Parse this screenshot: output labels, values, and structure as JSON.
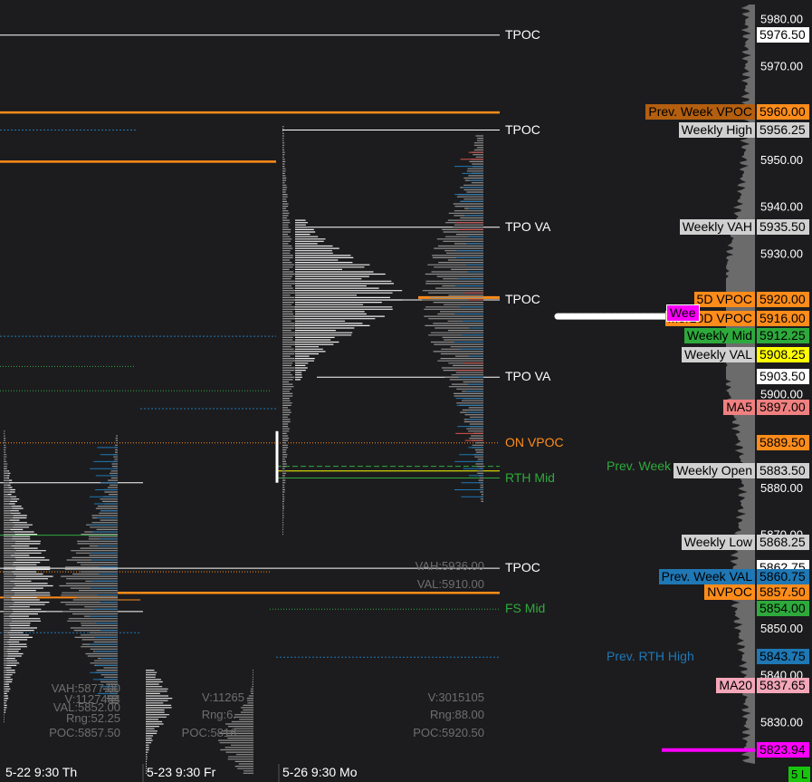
{
  "chart_data": {
    "type": "market-profile",
    "y_axis": {
      "min": 5821,
      "max": 5984,
      "ticks": [
        "5980.00",
        "5970.00",
        "5950.00",
        "5940.00",
        "5930.00",
        "5900.00",
        "5880.00",
        "5870.00",
        "5850.00",
        "5840.00",
        "5830.00"
      ]
    },
    "sessions": [
      {
        "date_label": "5-22  9:30 Th",
        "stats": [
          "VAH:5877.00",
          "V:1127484",
          "VAL:5852.00",
          "Rng:52.25",
          "POC:5857.50"
        ]
      },
      {
        "date_label": "5-23  9:30 Fr",
        "stats": [
          "V:11265",
          "Rng:6.",
          "POC:5816."
        ]
      },
      {
        "date_label": "5-26  9:30 Mo",
        "stats": [
          "VAH:5936.00",
          "VAL:5910.00",
          "V:3015105",
          "Rng:88.00",
          "POC:5920.50"
        ]
      }
    ],
    "chart_lines": [
      {
        "label": "TPOC",
        "price": 5976.5,
        "color": "#ffffff"
      },
      {
        "label": "TPOC",
        "price": 5956.25,
        "color": "#ffffff"
      },
      {
        "label": "TPO VA",
        "price": 5935.5,
        "color": "#ffffff"
      },
      {
        "label": "TPOC",
        "price": 5920.0,
        "color": "#ffffff"
      },
      {
        "label": "TPO VA",
        "price": 5903.5,
        "color": "#ffffff"
      },
      {
        "label": "ON VPOC",
        "price": 5889.5,
        "color": "#ff8c1a"
      },
      {
        "label": "Prev. Week",
        "price": 5884.5,
        "color": "#2eaa3c"
      },
      {
        "label": "RTH Mid",
        "price": 5882.0,
        "color": "#2eaa3c"
      },
      {
        "label": "TPOC",
        "price": 5862.75,
        "color": "#ffffff"
      },
      {
        "label": "FS Mid",
        "price": 5854.0,
        "color": "#2eaa3c"
      },
      {
        "label": "Prev. RTH High",
        "price": 5843.75,
        "color": "#1f77b4"
      }
    ],
    "price_tags": [
      {
        "label": "",
        "price": "5976.50",
        "bg": "#ffffff",
        "fg": "#000000",
        "y": 5976.5
      },
      {
        "label": "Prev. Week VPOC",
        "price": "5960.00",
        "bg": "#ff8c1a",
        "label_bg": "#b35f0f",
        "fg": "#000000",
        "y": 5960.0
      },
      {
        "label": "Weekly High",
        "price": "5956.25",
        "bg": "#d0d0d0",
        "fg": "#000000",
        "y": 5956.25
      },
      {
        "label": "Weekly VAH",
        "price": "5935.50",
        "bg": "#d0d0d0",
        "fg": "#000000",
        "y": 5935.5
      },
      {
        "label": "5D VPOC",
        "price": "5920.00",
        "bg": "#ff8c1a",
        "fg": "#000000",
        "y": 5920.0
      },
      {
        "label": "Mor20D VPOC",
        "price": "5916.00",
        "bg": "#ff8c1a",
        "fg": "#000000",
        "y": 5916.0
      },
      {
        "label": "Weekly Mid",
        "price": "5912.25",
        "bg": "#2eaa3c",
        "fg": "#000000",
        "y": 5912.25
      },
      {
        "label": "Weekly VAL",
        "price": "5908.25",
        "bg": "#ffff00",
        "label_bg": "#d0d0d0",
        "fg": "#000000",
        "y": 5908.25
      },
      {
        "label": "",
        "price": "5903.50",
        "bg": "#ffffff",
        "fg": "#000000",
        "y": 5903.5
      },
      {
        "label": "MA5",
        "price": "5897.00",
        "bg": "#f08080",
        "fg": "#000000",
        "y": 5897.0
      },
      {
        "label": "",
        "price": "5889.50",
        "bg": "#ff8c1a",
        "fg": "#000000",
        "y": 5889.5
      },
      {
        "label": "Weekly Open",
        "price": "5883.50",
        "bg": "#d0d0d0",
        "fg": "#000000",
        "y": 5883.5
      },
      {
        "label": "Weekly Low",
        "price": "5868.25",
        "bg": "#d0d0d0",
        "fg": "#000000",
        "y": 5868.25
      },
      {
        "label": "",
        "price": "5862.75",
        "bg": "#ffffff",
        "fg": "#000000",
        "y": 5862.75
      },
      {
        "label": "Prev. Week VAL",
        "price": "5860.75",
        "bg": "#1f77b4",
        "fg": "#000000",
        "y": 5860.75
      },
      {
        "label": "NVPOC",
        "price": "5857.50",
        "bg": "#ff8c1a",
        "fg": "#000000",
        "y": 5857.5
      },
      {
        "label": "",
        "price": "5854.00",
        "bg": "#2eaa3c",
        "fg": "#000000",
        "y": 5854.0
      },
      {
        "label": "",
        "price": "5843.75",
        "bg": "#1f77b4",
        "fg": "#000000",
        "y": 5843.75
      },
      {
        "label": "MA20",
        "price": "5837.65",
        "bg": "#f4a7b9",
        "fg": "#000000",
        "y": 5837.65
      },
      {
        "label": "",
        "price": "5823.94",
        "bg": "#ff00ff",
        "fg": "#000000",
        "y": 5823.94
      }
    ],
    "weekly_label_fragment": "Wee",
    "bottom_indicator": "5 L"
  }
}
